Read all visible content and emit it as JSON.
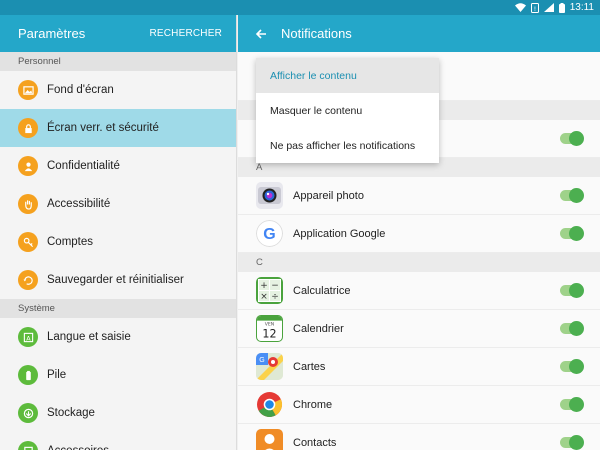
{
  "statusbar": {
    "time": "13:11"
  },
  "settings": {
    "title": "Paramètres",
    "search_label": "RECHERCHER",
    "sections": [
      {
        "name": "Personnel",
        "items": [
          {
            "label": "Fond d'écran",
            "icon": "wallpaper-icon",
            "color": "#f5a11e"
          },
          {
            "label": "Écran verr. et sécurité",
            "icon": "lock-icon",
            "color": "#f5a11e",
            "active": true
          },
          {
            "label": "Confidentialité",
            "icon": "privacy-icon",
            "color": "#f5a11e"
          },
          {
            "label": "Accessibilité",
            "icon": "hand-icon",
            "color": "#f5a11e"
          },
          {
            "label": "Comptes",
            "icon": "key-icon",
            "color": "#f5a11e"
          },
          {
            "label": "Sauvegarder et réinitialiser",
            "icon": "backup-icon",
            "color": "#f5a11e"
          }
        ]
      },
      {
        "name": "Système",
        "items": [
          {
            "label": "Langue et saisie",
            "icon": "language-icon",
            "color": "#5dbb3c"
          },
          {
            "label": "Pile",
            "icon": "battery-icon",
            "color": "#5dbb3c"
          },
          {
            "label": "Stockage",
            "icon": "storage-icon",
            "color": "#5dbb3c"
          },
          {
            "label": "Accessoires",
            "icon": "accessories-icon",
            "color": "#5dbb3c"
          }
        ]
      }
    ]
  },
  "notifications": {
    "title": "Notifications",
    "menu": [
      {
        "label": "Afficher le contenu",
        "selected": true
      },
      {
        "label": "Masquer le contenu",
        "selected": false
      },
      {
        "label": "Ne pas afficher les notifications",
        "selected": false
      }
    ],
    "groups": [
      {
        "letter": "A",
        "apps": [
          {
            "name": "Appareil photo",
            "icon": "camera-icon",
            "enabled": true
          },
          {
            "name": "Application Google",
            "icon": "google-icon",
            "enabled": true
          }
        ]
      },
      {
        "letter": "C",
        "apps": [
          {
            "name": "Calculatrice",
            "icon": "calculator-icon",
            "enabled": true
          },
          {
            "name": "Calendrier",
            "icon": "calendar-icon",
            "enabled": true,
            "icon_text": "VEN",
            "icon_day": "12"
          },
          {
            "name": "Cartes",
            "icon": "maps-icon",
            "enabled": true
          },
          {
            "name": "Chrome",
            "icon": "chrome-icon",
            "enabled": true
          },
          {
            "name": "Contacts",
            "icon": "contacts-icon",
            "enabled": true
          }
        ]
      }
    ]
  }
}
